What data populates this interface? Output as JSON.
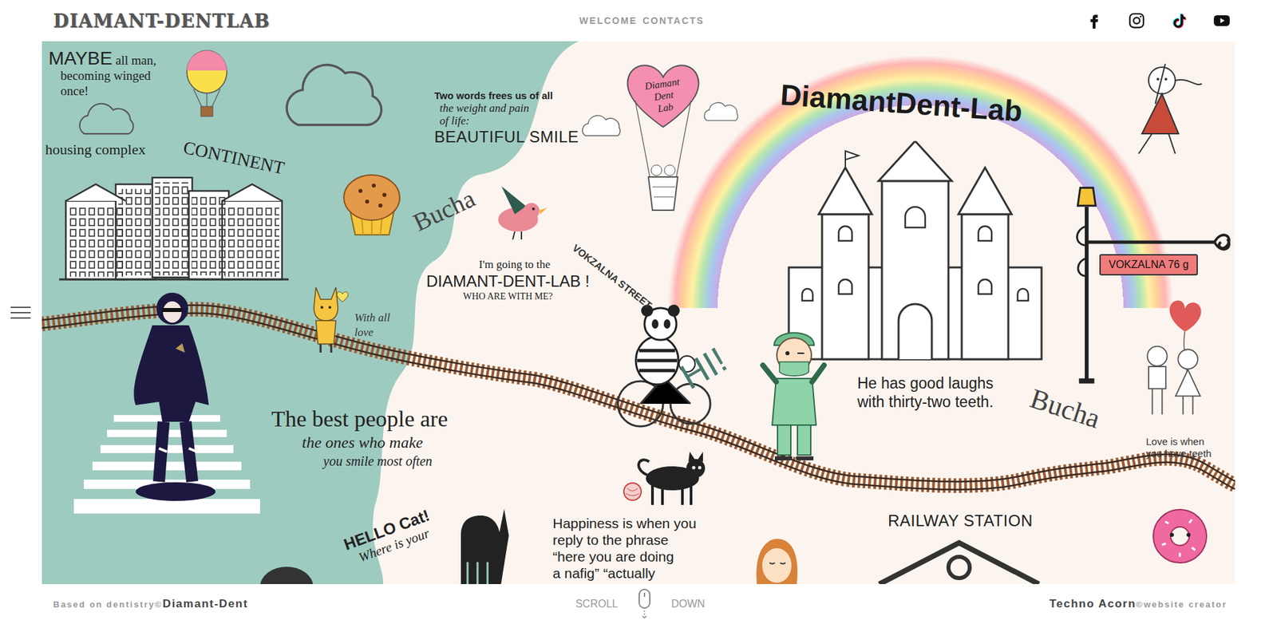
{
  "header": {
    "logo": "DIAMANT-DENTLAB",
    "nav": [
      "WELCOME",
      "CONTACTS"
    ]
  },
  "canvas": {
    "maybe": {
      "big": "MAYBE",
      "first": "all man,",
      "lines": [
        "becoming winged",
        "once!"
      ]
    },
    "housing": "housing complex",
    "continent": "CONTINENT",
    "two_words": {
      "lines": [
        "Two words frees us of all",
        "the weight and pain",
        "of life:"
      ],
      "big": "BEAUTIFUL SMILE"
    },
    "balloon_label": [
      "Diamant",
      "Dent",
      "Lab"
    ],
    "rainbow_title": "DiamantDent-Lab",
    "bucha_left": "Bucha",
    "street": "VOKZALNA STREET",
    "sign": "VOKZALNA 76 g",
    "going": [
      "I'm going to the",
      "DIAMANT-DENT-LAB !",
      "WHO ARE WITH ME?"
    ],
    "fox_note": [
      "With all",
      "love"
    ],
    "hi": "HI!",
    "laughs": [
      "He has good laughs",
      "with thirty-two teeth."
    ],
    "bucha_right": "Bucha",
    "love": [
      "Love is when",
      "you have teeth"
    ],
    "best": [
      "The best people are",
      "the ones who make",
      "you smile most often"
    ],
    "hello": [
      "HELLO Cat!",
      "Where is your"
    ],
    "happiness": [
      "Happiness is when you",
      "reply to the phrase",
      "“here you are doing",
      "a nafig” “actually"
    ],
    "railway": "RAILWAY STATION"
  },
  "footer": {
    "left_small": "Based on dentistry©",
    "left_bold": "Diamant-Dent",
    "scroll": "SCROLL",
    "down": "DOWN",
    "right_bold": "Techno Acorn",
    "right_small": "©website creator"
  }
}
